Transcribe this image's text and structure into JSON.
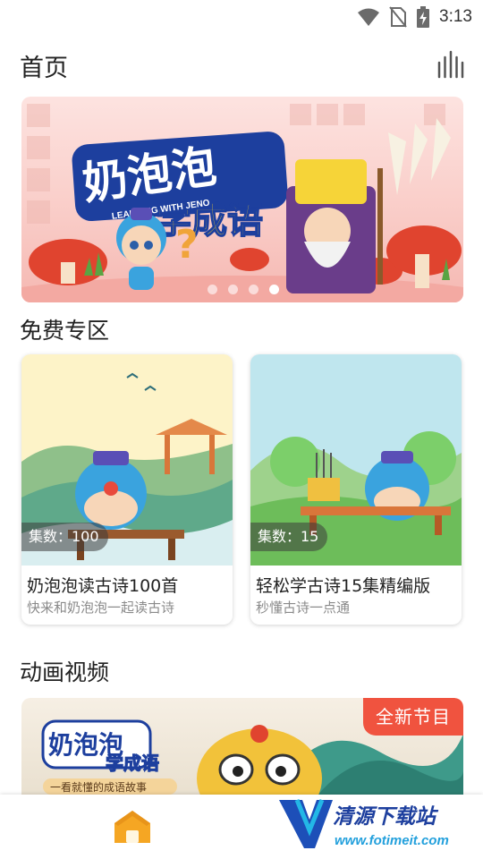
{
  "status_bar": {
    "time": "3:13"
  },
  "header": {
    "title": "首页"
  },
  "banner": {
    "logo_main": "奶泡泡",
    "logo_sub": "学成语",
    "logo_en": "LEARNING WITH JENO",
    "dots": 4,
    "active_dot": 4
  },
  "free_section": {
    "title": "免费专区",
    "cards": [
      {
        "badge": "集数：100",
        "title": "奶泡泡读古诗100首",
        "subtitle": "快来和奶泡泡一起读古诗"
      },
      {
        "badge": "集数：15",
        "title": "轻松学古诗15集精编版",
        "subtitle": "秒懂古诗一点通"
      }
    ]
  },
  "video_section": {
    "title": "动画视频",
    "tag": "全新节目",
    "logo_main": "奶泡泡",
    "logo_sub": "学成语",
    "caption": "一看就懂的成语故事"
  },
  "watermark": {
    "brand": "清源下载站",
    "url": "www.fotimeit.com"
  },
  "colors": {
    "accent_orange": "#f5a623",
    "tag_red": "#f0533f",
    "banner_pink": "#f9cbc6"
  }
}
